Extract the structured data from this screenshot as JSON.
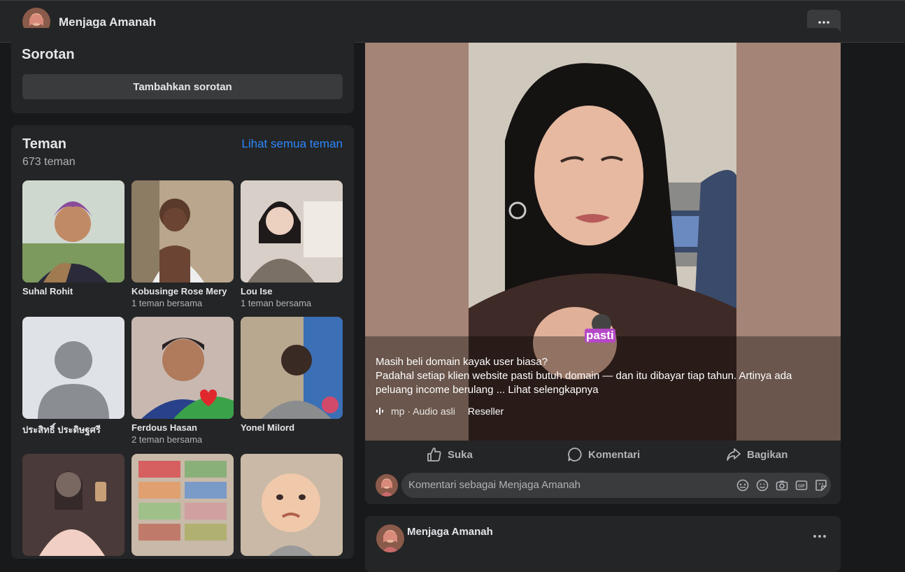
{
  "header": {
    "profile_name": "Menjaga Amanah",
    "more_icon": "more-horizontal-icon"
  },
  "highlights": {
    "title": "Sorotan",
    "add_button": "Tambahkan sorotan"
  },
  "friends": {
    "title": "Teman",
    "count": "673 teman",
    "see_all": "Lihat semua teman",
    "items": [
      {
        "name": "Suhal Rohit",
        "mutual": ""
      },
      {
        "name": "Kobusinge Rose Mery",
        "mutual": "1 teman bersama"
      },
      {
        "name": "Lou Ise",
        "mutual": "1 teman bersama"
      },
      {
        "name": "ประสิทธิ์ ประดิษฐศรี",
        "mutual": ""
      },
      {
        "name": "Ferdous Hasan",
        "mutual": "2 teman bersama"
      },
      {
        "name": "Yonel Milord",
        "mutual": ""
      }
    ]
  },
  "post": {
    "video_overlay_text": "pasti",
    "caption_line1": "Masih beli domain kayak user biasa?",
    "caption_line2": "Padahal setiap klien website pasti butuh domain — dan itu dibayar tiap tahun. Artinya ada peluang income berulang ...",
    "see_more": "Lihat selengkapnya",
    "audio_label": "mp · Audio asli",
    "audio_extra": "Reseller",
    "actions": {
      "like": "Suka",
      "comment": "Komentari",
      "share": "Bagikan"
    },
    "comment_placeholder": "Komentari sebagai Menjaga Amanah"
  },
  "next_post": {
    "author": "Menjaga Amanah"
  },
  "colors": {
    "accent": "#2d88ff",
    "card": "#242526",
    "background": "#18191a"
  }
}
